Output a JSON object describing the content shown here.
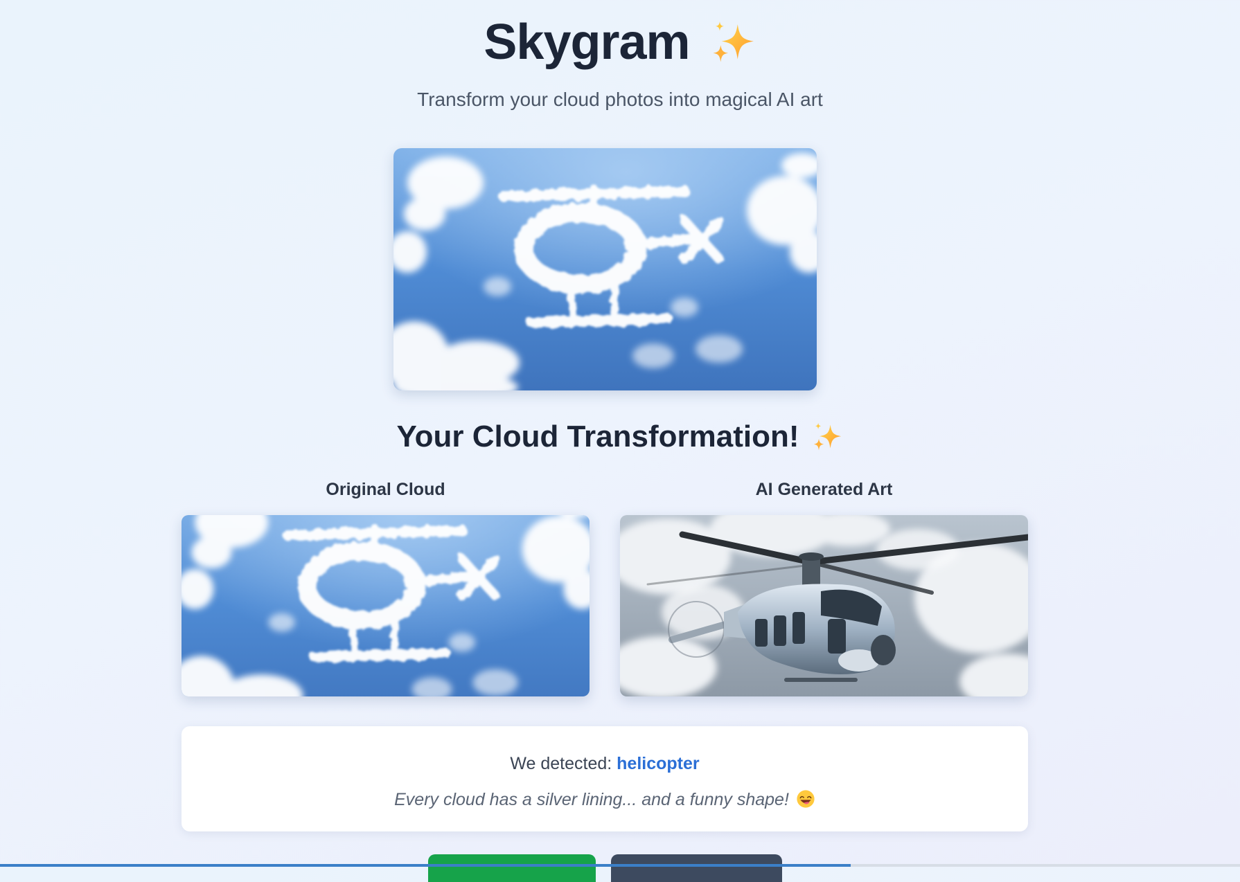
{
  "app": {
    "title": "Skygram",
    "title_icon": "sparkles-icon",
    "subtitle": "Transform your cloud photos into magical AI art"
  },
  "upload": {
    "image": "helicopter-cloud-photo"
  },
  "result": {
    "heading": "Your Cloud Transformation!",
    "heading_icon": "sparkles-icon",
    "original_label": "Original Cloud",
    "original_image": "helicopter-cloud-photo",
    "generated_label": "AI Generated Art",
    "generated_image": "helicopter-ai-art",
    "detected_prefix": "We detected:",
    "detected_value": "helicopter",
    "quote": "Every cloud has a silver lining... and a funny shape!",
    "quote_icon": "grinning-face-emoji"
  },
  "actions": {
    "primary_label": "",
    "secondary_label": ""
  },
  "colors": {
    "accent": "#2b6fd6",
    "primary_button": "#16a34a",
    "secondary_button": "#3d4a5f"
  }
}
